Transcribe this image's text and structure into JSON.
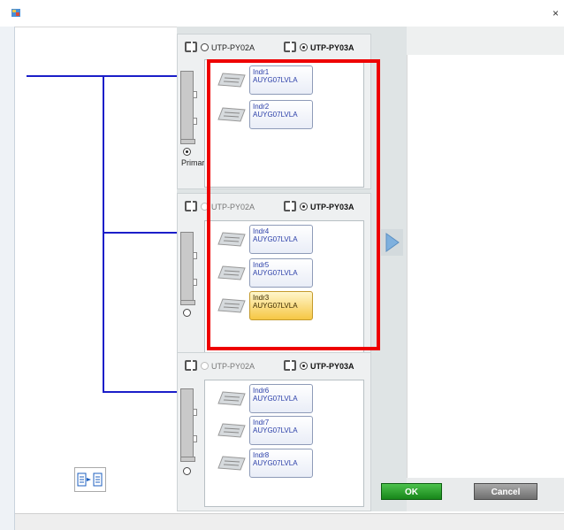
{
  "window": {
    "title": "",
    "close_glyph": "×"
  },
  "options": {
    "a": "UTP-PY02A",
    "b": "UTP-PY03A"
  },
  "groups": [
    {
      "header": {
        "selected": "b"
      },
      "outdoor_radio_selected": true,
      "primary_label": "Primary",
      "units": [
        {
          "name": "Indr1",
          "model": "AUYG07LVLA",
          "selected": false
        },
        {
          "name": "Indr2",
          "model": "AUYG07LVLA",
          "selected": false
        }
      ]
    },
    {
      "header": {
        "selected": "b"
      },
      "outdoor_radio_selected": false,
      "units": [
        {
          "name": "Indr4",
          "model": "AUYG07LVLA",
          "selected": false
        },
        {
          "name": "Indr5",
          "model": "AUYG07LVLA",
          "selected": false
        },
        {
          "name": "Indr3",
          "model": "AUYG07LVLA",
          "selected": true
        }
      ]
    },
    {
      "header": {
        "selected": "b"
      },
      "outdoor_radio_selected": false,
      "units": [
        {
          "name": "Indr6",
          "model": "AUYG07LVLA",
          "selected": false
        },
        {
          "name": "Indr7",
          "model": "AUYG07LVLA",
          "selected": false
        },
        {
          "name": "Indr8",
          "model": "AUYG07LVLA",
          "selected": false
        }
      ]
    }
  ],
  "buttons": {
    "ok": "OK",
    "cancel": "Cancel"
  },
  "colors": {
    "pipe": "#1b1ec9",
    "highlight": "#ee0000",
    "ok": "#17861a",
    "cancel": "#6f6f6f",
    "card_selected": "#f6c744"
  }
}
